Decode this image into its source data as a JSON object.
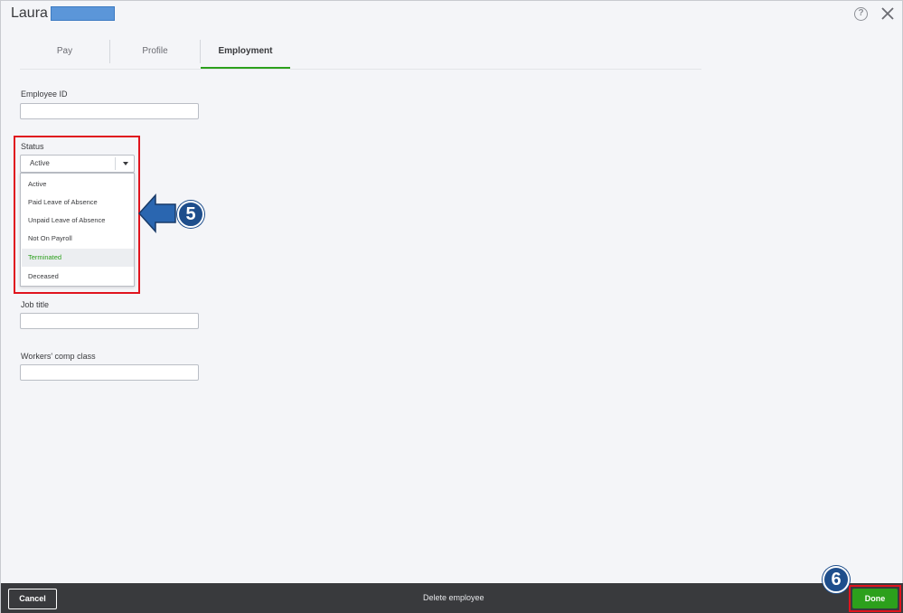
{
  "header": {
    "employee_first_name": "Laura",
    "help_icon": "help-circle-icon",
    "close_icon": "close-icon"
  },
  "tabs": [
    {
      "label": "Pay",
      "active": false
    },
    {
      "label": "Profile",
      "active": false
    },
    {
      "label": "Employment",
      "active": true
    }
  ],
  "form": {
    "employee_id": {
      "label": "Employee ID",
      "value": ""
    },
    "status": {
      "label": "Status",
      "selected": "Active",
      "options": [
        "Active",
        "Paid Leave of Absence",
        "Unpaid Leave of Absence",
        "Not On Payroll",
        "Terminated",
        "Deceased"
      ],
      "highlighted": "Terminated"
    },
    "job_title": {
      "label": "Job title",
      "value": ""
    },
    "workers_comp": {
      "label": "Workers' comp class",
      "value": ""
    }
  },
  "callouts": {
    "step5": "5",
    "step6": "6"
  },
  "footer": {
    "cancel_label": "Cancel",
    "delete_label": "Delete employee",
    "done_label": "Done"
  },
  "colors": {
    "accent_green": "#2ca01c",
    "highlight_red": "#e0141e",
    "callout_blue": "#1e4e8c",
    "redaction_blue": "#5b96d9"
  }
}
